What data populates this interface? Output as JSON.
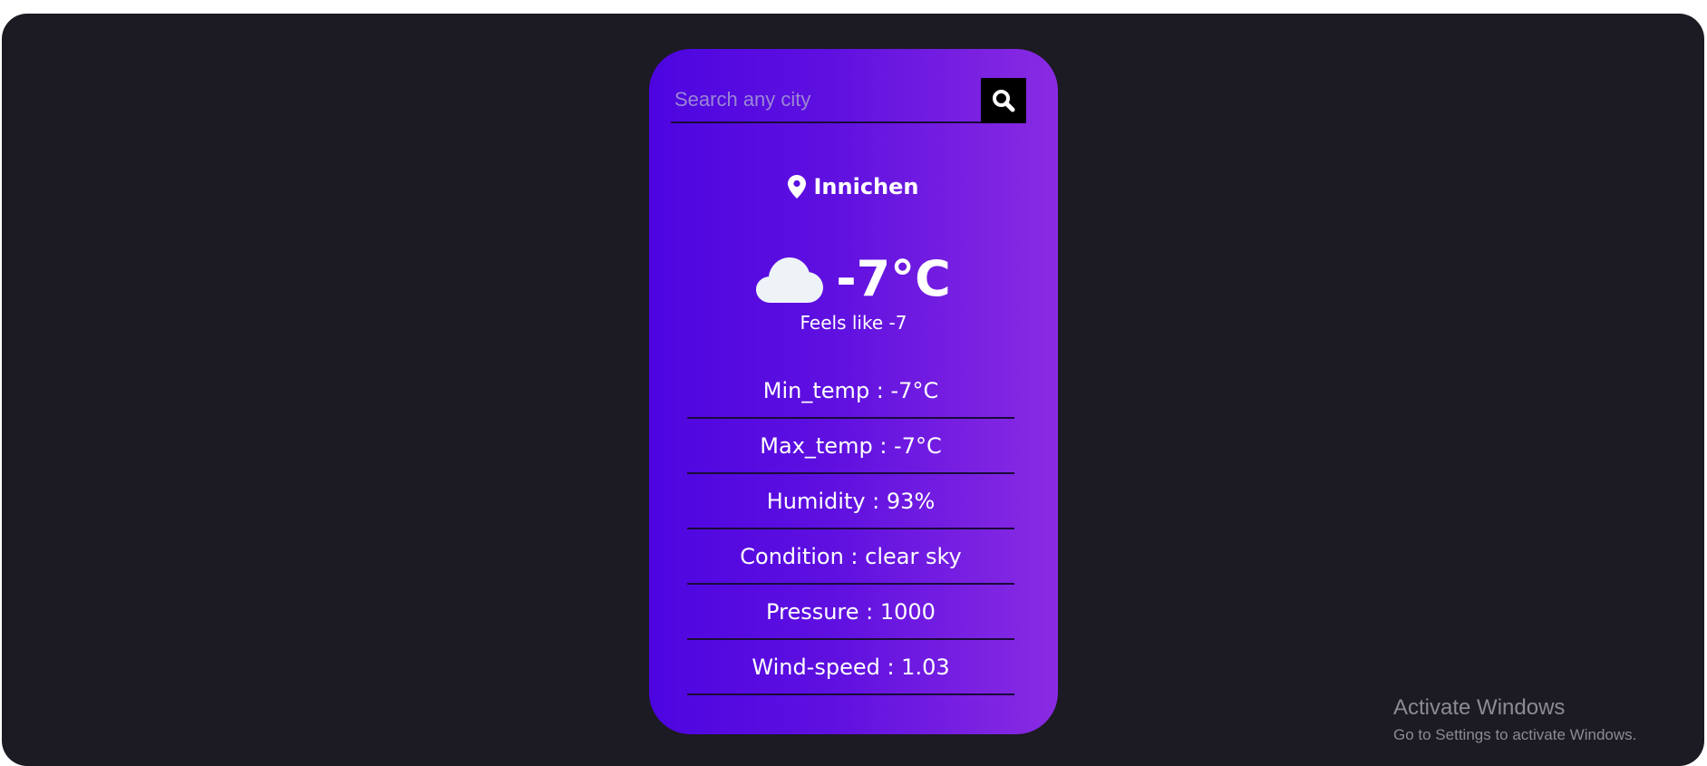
{
  "search": {
    "placeholder": "Search any city",
    "value": ""
  },
  "location": {
    "city": "Innichen"
  },
  "current": {
    "icon": "cloud-icon",
    "temperature": "-7°C",
    "feels_like": "Feels like -7"
  },
  "details": [
    {
      "label": "Min_temp : -7°C"
    },
    {
      "label": "Max_temp : -7°C"
    },
    {
      "label": "Humidity : 93%"
    },
    {
      "label": "Condition : clear sky"
    },
    {
      "label": "Pressure : 1000"
    },
    {
      "label": "Wind-speed : 1.03"
    }
  ],
  "watermark": {
    "title": "Activate Windows",
    "subtitle": "Go to Settings to activate Windows."
  },
  "colors": {
    "background": "#1c1a22",
    "card_gradient_start": "#4d05e0",
    "card_gradient_end": "#8a2be2",
    "text": "#ffffff"
  }
}
